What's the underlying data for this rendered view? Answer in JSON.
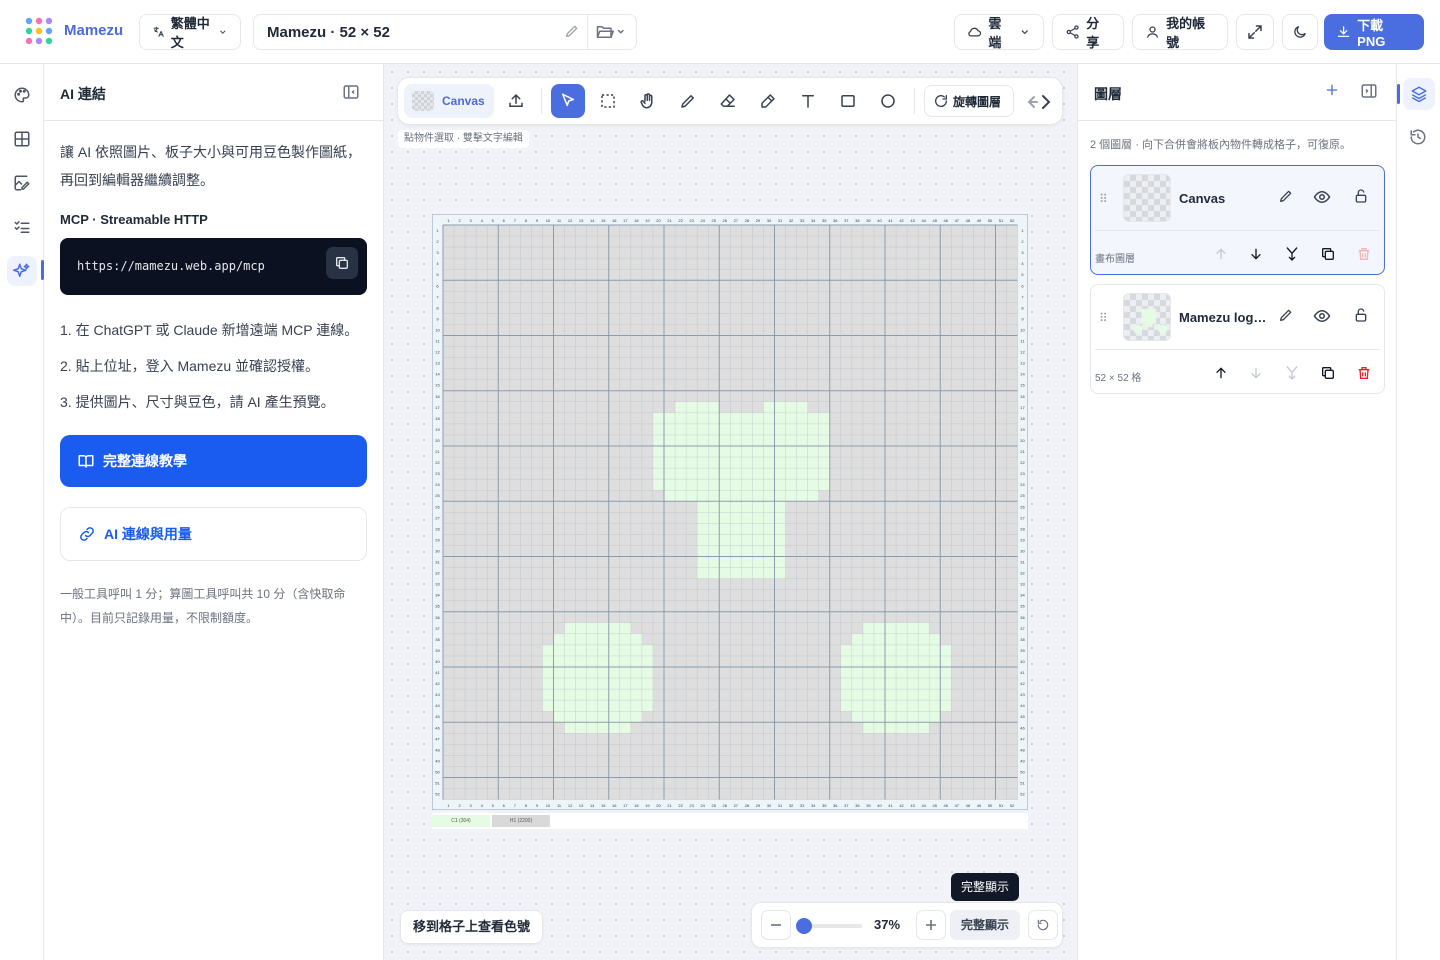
{
  "app": {
    "brand": "Mamezu",
    "language": "繁體中文",
    "document_title": "Mamezu · 52 × 52"
  },
  "topbar": {
    "cloud_label": "雲端",
    "share_label": "分享",
    "account_label": "我的帳號",
    "download_label": "下載 PNG"
  },
  "left_rail": {
    "items": [
      "palette-icon",
      "grid-icon",
      "image-edit-icon",
      "checklist-icon",
      "ai-sparkle-icon"
    ],
    "active": "ai-sparkle-icon"
  },
  "ai_panel": {
    "title": "AI 連結",
    "description": "讓 AI 依照圖片、板子大小與可用豆色製作圖紙，再回到編輯器繼續調整。",
    "mcp_heading": "MCP · Streamable HTTP",
    "mcp_url": "https://mamezu.web.app/mcp",
    "steps": [
      "1. 在 ChatGPT 或 Claude 新增遠端 MCP 連線。",
      "2. 貼上位址，登入 Mamezu 並確認授權。",
      "3. 提供圖片、尺寸與豆色，請 AI 產生預覽。"
    ],
    "tutorial_button": "完整連線教學",
    "usage_button": "AI 連線與用量",
    "footnote": "一般工具呼叫 1 分；算圖工具呼叫共 10 分（含快取命中）。目前只記錄用量，不限制額度。"
  },
  "toolbar": {
    "layer_chip": "Canvas",
    "tools": [
      "upload-icon",
      "select-arrow-icon",
      "marquee-select-icon",
      "hand-icon",
      "pencil-icon",
      "eraser-icon",
      "eyedropper-icon",
      "text-icon",
      "rectangle-icon",
      "circle-icon"
    ],
    "active_tool": "select-arrow-icon",
    "rotate_label": "旋轉圖層",
    "hint": "點物件選取 · 雙擊文字編輯"
  },
  "board": {
    "columns": 52,
    "rows": 52,
    "background_color": "#dedede",
    "bead_color": "#e6fbe4",
    "grid_line_color": "#a9b5c2",
    "major_line_color": "#8296aa"
  },
  "legend": [
    {
      "label": "C1 (304)",
      "color": "#e6fbe4"
    },
    {
      "label": "H1 (2200)",
      "color": "#d9d9d9"
    }
  ],
  "status": {
    "hover_hint": "移到格子上查看色號",
    "zoom_percent": 37,
    "zoom_label": "37%",
    "fit_label": "完整顯示",
    "tooltip": "完整顯示"
  },
  "layers_panel": {
    "title": "圖層",
    "description": "2 個圖層 · 向下合併會將板內物件轉成格子，可復原。",
    "layers": [
      {
        "name": "Canvas",
        "meta": "畫布圖層",
        "selected": true
      },
      {
        "name": "Mamezu log…",
        "meta": "52 × 52 格",
        "selected": false
      }
    ]
  },
  "right_rail": {
    "items": [
      "layers-icon",
      "history-icon"
    ],
    "active": "layers-icon"
  }
}
